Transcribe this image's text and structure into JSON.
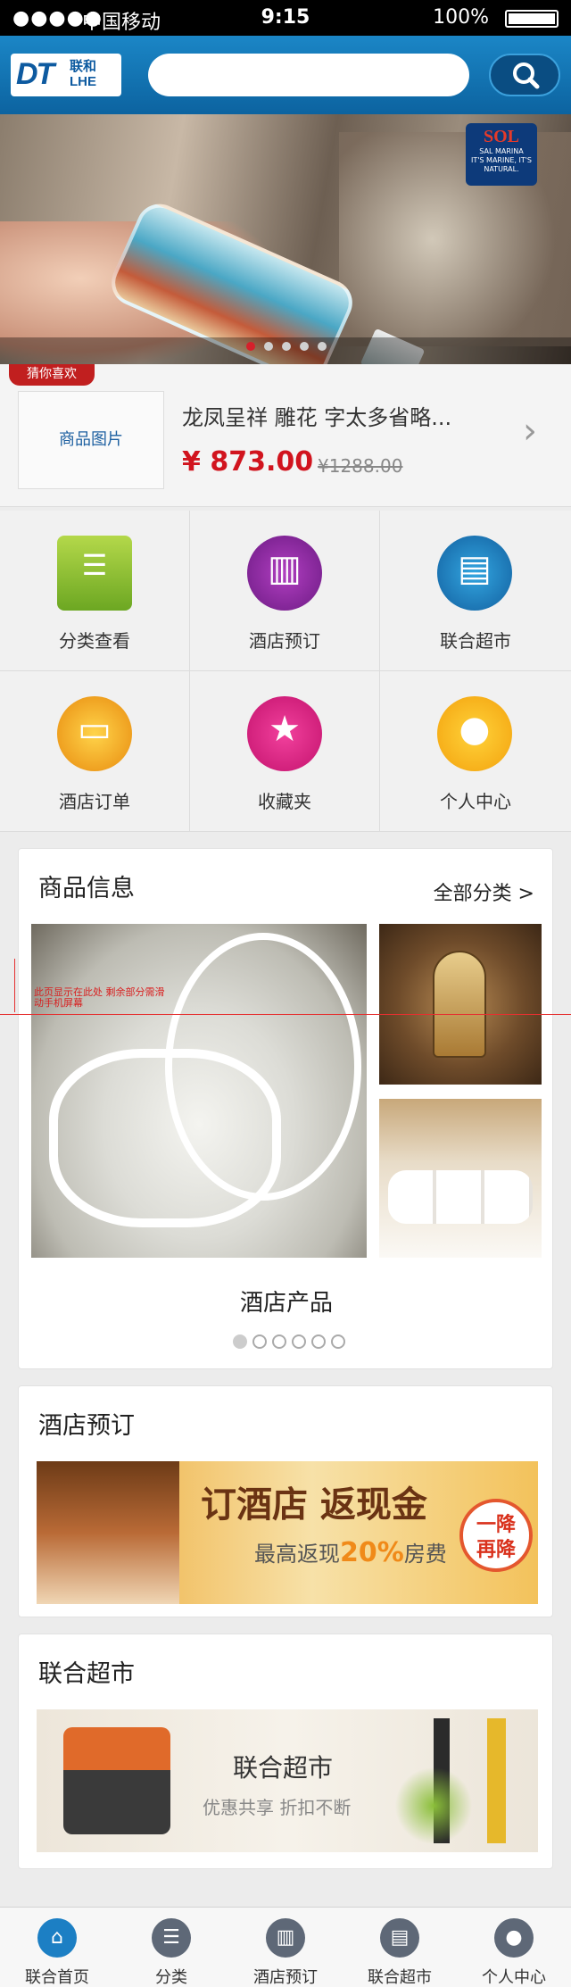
{
  "status_bar": {
    "signal": "●●●●●",
    "carrier": "中国移动",
    "time": "9:15",
    "battery": "100%"
  },
  "header": {
    "logo_main": "DT",
    "logo_sub": "联和",
    "logo_sub2": "LHE",
    "search_placeholder": ""
  },
  "banner": {
    "brand": "SOL",
    "brand_line1": "SAL MARINA",
    "brand_line2": "IT'S MARINE, IT'S NATURAL.",
    "slide_count": 5,
    "active_slide": 1
  },
  "recommend": {
    "tag": "猜你喜欢",
    "image_placeholder": "商品图片",
    "title": "龙凤呈祥 雕花 字太多省略...",
    "price": "¥ 873.00",
    "old_price": "¥1288.00",
    "arrow": "›"
  },
  "grid": {
    "items": [
      {
        "label": "分类查看",
        "icon": "sale-list-icon"
      },
      {
        "label": "酒店预订",
        "icon": "hotel-building-icon"
      },
      {
        "label": "联合超市",
        "icon": "shopping-bag-icon"
      },
      {
        "label": "酒店订单",
        "icon": "bed-icon"
      },
      {
        "label": "收藏夹",
        "icon": "star-cloud-icon"
      },
      {
        "label": "个人中心",
        "icon": "user-icon"
      }
    ]
  },
  "goods": {
    "title": "商品信息",
    "more": "全部分类 >",
    "caption": "酒店产品",
    "dot_count": 6,
    "annotation": "此页显示在此处 剩余部分需滑动手机屏幕"
  },
  "hotel": {
    "title": "酒店预订",
    "headline": "订酒店 返现金",
    "sub_prefix": "最高返现",
    "sub_percent": "20%",
    "sub_suffix": "房费",
    "badge_line1": "一降",
    "badge_line2": "再降"
  },
  "mart": {
    "title": "联合超市",
    "banner_title": "联合超市",
    "banner_sub": "优惠共享 折扣不断"
  },
  "nav": {
    "items": [
      {
        "label": "联合首页",
        "icon": "home-icon",
        "active": true
      },
      {
        "label": "分类",
        "icon": "list-icon",
        "active": false
      },
      {
        "label": "酒店预订",
        "icon": "hotel-icon",
        "active": false
      },
      {
        "label": "联合超市",
        "icon": "bag-icon",
        "active": false
      },
      {
        "label": "个人中心",
        "icon": "person-icon",
        "active": false
      }
    ]
  },
  "colors": {
    "brand_blue": "#0c63a0",
    "price_red": "#d1141e",
    "accent_orange": "#f08a19"
  }
}
